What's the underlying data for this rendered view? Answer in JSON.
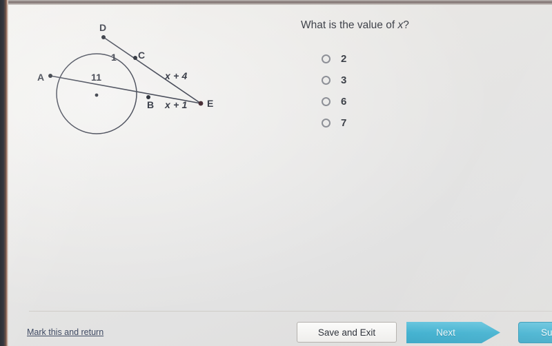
{
  "question": {
    "text_before_var": "What is the value of ",
    "variable": "x",
    "text_after_var": "?"
  },
  "answers": [
    {
      "label": "2",
      "selected": false
    },
    {
      "label": "3",
      "selected": false
    },
    {
      "label": "6",
      "selected": false
    },
    {
      "label": "7",
      "selected": false
    }
  ],
  "diagram": {
    "type": "circle-secant-geometry",
    "point_labels": {
      "A": "A",
      "B": "B",
      "C": "C",
      "D": "D",
      "E": "E"
    },
    "segment_labels": {
      "chord_DC": "1",
      "chord_AB": "11",
      "secant_CE": "x + 4",
      "secant_BE": "x + 1"
    }
  },
  "toolbar": {
    "mark_link": "Mark this and return",
    "save_exit": "Save and Exit",
    "next": "Next",
    "submit": "Sub"
  },
  "colors": {
    "accent_cyan": "#3fb0cf",
    "link_blue": "#3f4a63",
    "text_dark": "#3c4048",
    "page_background": "#e7e6e4",
    "diagram_stroke": "#474b58"
  }
}
